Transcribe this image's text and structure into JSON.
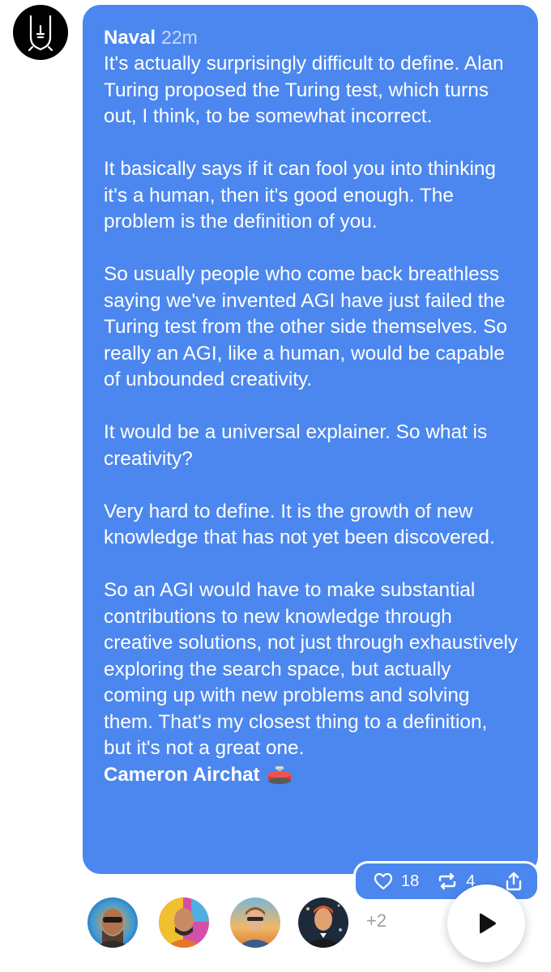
{
  "post": {
    "author": "Naval",
    "time": "22m",
    "paragraphs": [
      "It's actually surprisingly difficult to define. Alan Turing proposed the Turing test, which turns out, I think, to be somewhat incorrect.",
      "It basically says if it can fool you into thinking it's a human, then it's good enough. The problem is the definition of you.",
      "So usually people who come back breathless saying we've invented AGI have just failed the Turing test from the other side themselves. So really an AGI, like a human, would be capable of unbounded creativity.",
      "It would be a universal explainer. So what is creativity?",
      "Very hard to define. It is the growth of new knowledge that has not yet been discovered.",
      "So an AGI would have to make substantial contributions to new knowledge through creative solutions, not just through exhaustively exploring the search space, but actually coming up with new problems and solving them. That's my closest thing to a definition, but it's not a great one."
    ],
    "footer": "Cameron Airchat",
    "footer_icon": "curling-stone-icon"
  },
  "actions": {
    "likes": "18",
    "reposts": "4",
    "like_icon": "heart-icon",
    "repost_icon": "repost-icon",
    "share_icon": "share-icon"
  },
  "listeners": {
    "more": "+2"
  },
  "player": {
    "icon": "play-icon"
  },
  "colors": {
    "bubble": "#4c87ef",
    "text": "#ffffff",
    "time": "#c8d9fb"
  }
}
